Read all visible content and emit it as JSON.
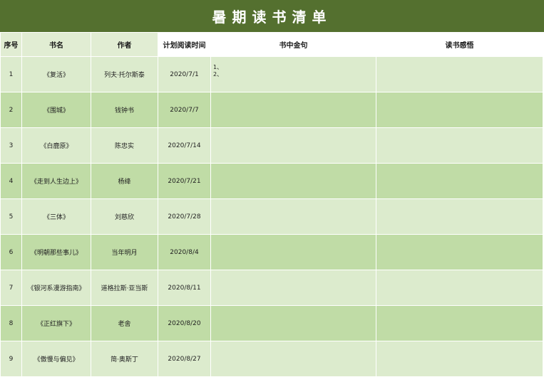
{
  "title": "暑期读书清单",
  "headers": {
    "index": "序号",
    "book": "书名",
    "author": "作者",
    "planned": "计划阅读时间",
    "quote": "书中金句",
    "thoughts": "读书感悟"
  },
  "rows": [
    {
      "index": "1",
      "book": "《复活》",
      "author": "列夫·托尔斯泰",
      "planned": "2020/7/1",
      "quote": [
        "1、",
        "2、"
      ],
      "thoughts": ""
    },
    {
      "index": "2",
      "book": "《围城》",
      "author": "钱钟书",
      "planned": "2020/7/7",
      "quote": [],
      "thoughts": ""
    },
    {
      "index": "3",
      "book": "《白鹿原》",
      "author": "陈忠实",
      "planned": "2020/7/14",
      "quote": [],
      "thoughts": ""
    },
    {
      "index": "4",
      "book": "《走到人生边上》",
      "author": "杨绛",
      "planned": "2020/7/21",
      "quote": [],
      "thoughts": ""
    },
    {
      "index": "5",
      "book": "《三体》",
      "author": "刘慈欣",
      "planned": "2020/7/28",
      "quote": [],
      "thoughts": ""
    },
    {
      "index": "6",
      "book": "《明朝那些事儿》",
      "author": "当年明月",
      "planned": "2020/8/4",
      "quote": [],
      "thoughts": ""
    },
    {
      "index": "7",
      "book": "《银河系漫游指南》",
      "author": "道格拉斯·亚当斯",
      "planned": "2020/8/11",
      "quote": [],
      "thoughts": ""
    },
    {
      "index": "8",
      "book": "《正红旗下》",
      "author": "老舍",
      "planned": "2020/8/20",
      "quote": [],
      "thoughts": ""
    },
    {
      "index": "9",
      "book": "《傲慢与偏见》",
      "author": "简·奥斯丁",
      "planned": "2020/8/27",
      "quote": [],
      "thoughts": ""
    }
  ],
  "colors": {
    "title_bg": "#54702f",
    "header_bg": "#e1edd3",
    "row_dark": "#c0dca6",
    "row_light": "#dcebcd"
  }
}
